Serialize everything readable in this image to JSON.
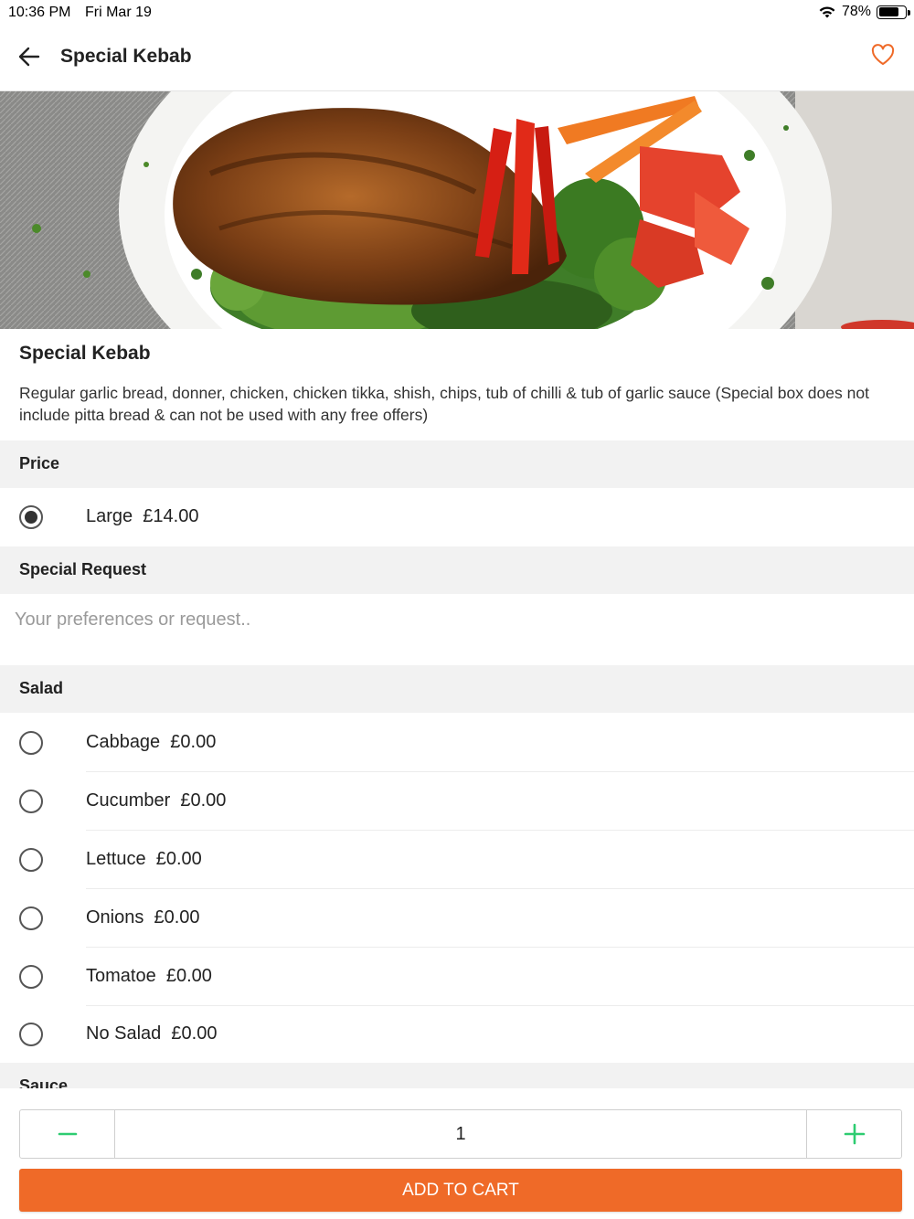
{
  "status_bar": {
    "time": "10:36 PM",
    "date": "Fri Mar 19",
    "battery": "78%",
    "battery_level": 0.78
  },
  "nav": {
    "title": "Special Kebab",
    "back_icon": "arrow-left-icon",
    "favorite_icon": "heart-outline-icon"
  },
  "item": {
    "name": "Special Kebab",
    "description": "Regular garlic bread, donner, chicken, chicken tikka, shish, chips, tub of chilli & tub of garlic sauce (Special box does not include pitta bread & can not be used with any free offers)"
  },
  "price_section": {
    "title": "Price",
    "options": [
      {
        "label": "Large  £14.00",
        "selected": true
      }
    ]
  },
  "special_request": {
    "title": "Special Request",
    "placeholder": "Your preferences or request..",
    "value": ""
  },
  "salad_section": {
    "title": "Salad",
    "options": [
      {
        "label": "Cabbage  £0.00",
        "selected": false
      },
      {
        "label": "Cucumber  £0.00",
        "selected": false
      },
      {
        "label": "Lettuce  £0.00",
        "selected": false
      },
      {
        "label": "Onions  £0.00",
        "selected": false
      },
      {
        "label": "Tomatoe  £0.00",
        "selected": false
      },
      {
        "label": "No Salad  £0.00",
        "selected": false
      }
    ]
  },
  "sauce_section": {
    "title": "Sauce"
  },
  "cart": {
    "quantity": "1",
    "add_label": "ADD TO CART"
  },
  "colors": {
    "accent": "#ef6a28",
    "stepper_icon": "#2ecc71",
    "section_bg": "#f2f2f2"
  }
}
